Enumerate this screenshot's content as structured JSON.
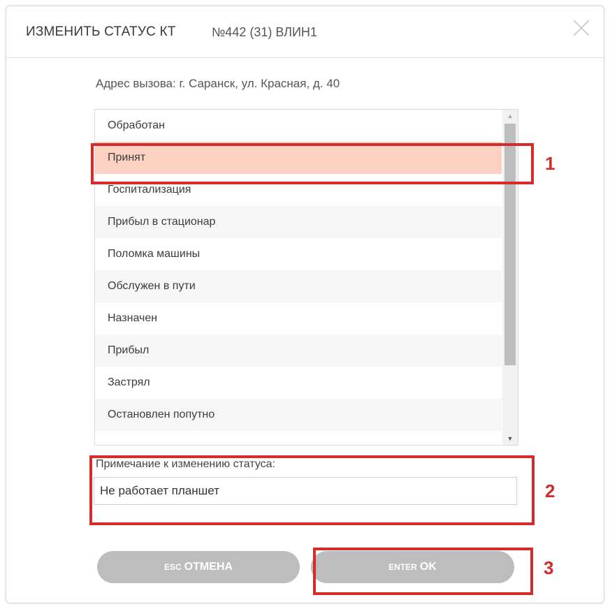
{
  "dialog": {
    "title": "ИЗМЕНИТЬ СТАТУС КТ",
    "subtitle": "№442 (31) ВЛИН1",
    "close_icon": "close-icon"
  },
  "address": {
    "text": "Адрес вызова: г. Саранск, ул. Красная, д. 40"
  },
  "status_list": {
    "selected": "Принят",
    "items": [
      {
        "label": "Обработан"
      },
      {
        "label": "Принят"
      },
      {
        "label": "Госпитализация"
      },
      {
        "label": "Прибыл в стационар"
      },
      {
        "label": "Поломка машины"
      },
      {
        "label": "Обслужен в пути"
      },
      {
        "label": "Назначен"
      },
      {
        "label": "Прибыл"
      },
      {
        "label": "Застрял"
      },
      {
        "label": "Остановлен попутно"
      }
    ],
    "scroll_up_icon": "triangle-up-icon",
    "scroll_down_icon": "triangle-down-icon"
  },
  "note": {
    "label": "Примечание к изменению статуса:",
    "value": "Не работает планшет"
  },
  "buttons": {
    "cancel_key": "ESC",
    "cancel_label": "ОТМЕНА",
    "ok_key": "ENTER",
    "ok_label": "OK"
  },
  "annotations": [
    "1",
    "2",
    "3"
  ],
  "colors": {
    "selected_row": "#fdd2c3",
    "highlight": "#d42c2c",
    "button_bg": "#bdbdbd"
  }
}
